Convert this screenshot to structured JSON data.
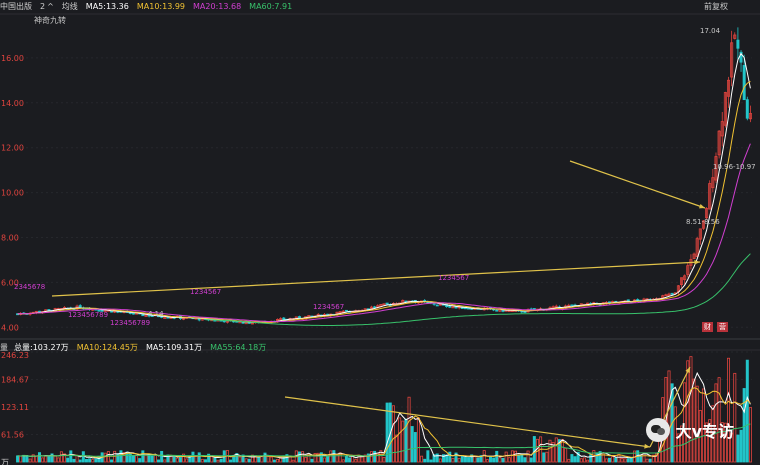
{
  "header": {
    "stock_name": "中国出版",
    "period_count": "2",
    "ma_label": "均线",
    "ma5": "MA5:13.36",
    "ma10": "MA10:13.99",
    "ma20": "MA20:13.68",
    "ma60": "MA60:7.91",
    "indicator": "神奇九转",
    "adjust": "前复权"
  },
  "volume_header": {
    "label": "量",
    "total": "总量:103.27万",
    "ma10": "MA10:124.45万",
    "ma5": "MA5:109.31万",
    "ma55": "MA55:64.18万"
  },
  "tags": {
    "cai": "财",
    "ying": "营"
  },
  "watermark": "大v专访",
  "colors": {
    "background": "#1b1c20",
    "up": "#e0443e",
    "down": "#22c5c9",
    "ma5": "#ffffff",
    "ma10": "#f1c232",
    "ma20": "#d13fd1",
    "ma60": "#38c26b",
    "arrow": "#e0c24a"
  },
  "chart_data": {
    "type": "candlestick",
    "price_axis_labels": [
      "16.00",
      "14.00",
      "12.00",
      "10.00",
      "8.00",
      "6.00",
      "4.00"
    ],
    "price_range": [
      3.7,
      17.6
    ],
    "volume_axis_labels": [
      "246.23",
      "184.67",
      "123.11",
      "61.56",
      "万"
    ],
    "volume_range": [
      0,
      246.23
    ],
    "annotations": {
      "high": "17.04",
      "low": "4.14",
      "range_a": "10.96-10.97",
      "range_b": "8.51-8.56"
    },
    "turn_counts": [
      {
        "text": "2345678",
        "tone": "red"
      },
      {
        "text": "123456789",
        "tone": "red"
      },
      {
        "text": "123456789",
        "tone": "red"
      },
      {
        "text": "1234567",
        "tone": "red"
      },
      {
        "text": "1234567",
        "tone": "red"
      },
      {
        "text": "1234567",
        "tone": "red"
      }
    ],
    "legend": [
      "MA5",
      "MA10",
      "MA20",
      "MA60"
    ]
  }
}
